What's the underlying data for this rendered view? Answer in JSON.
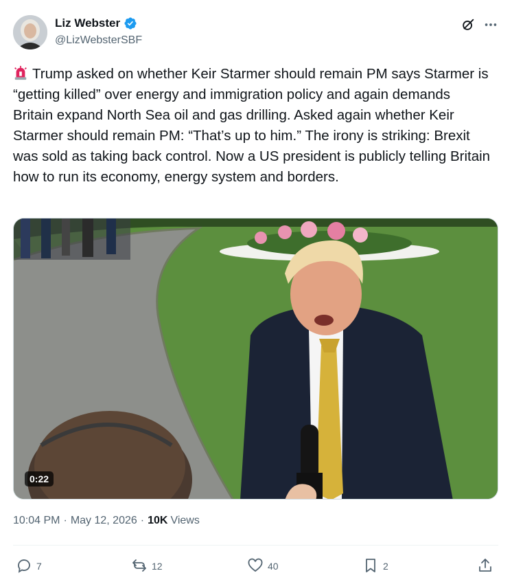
{
  "author": {
    "display_name": "Liz Webster",
    "handle": "@LizWebsterSBF",
    "verified": true,
    "avatar_icon": "profile-photo"
  },
  "header_actions": {
    "grok_icon": "grok-icon",
    "more_icon": "more-horizontal-icon"
  },
  "tweet": {
    "emoji_icon": "police-light-emoji",
    "text": "Trump asked on whether Keir Starmer should remain PM says Starmer is “getting killed” over energy and immigration policy and again demands Britain expand North Sea oil and gas drilling. Asked again whether Keir Starmer should remain PM: “That’s up to him.” The irony is striking: Brexit was sold as taking back control. Now a US president is publicly telling Britain how to run its economy, energy system and borders."
  },
  "media": {
    "type": "video",
    "duration": "0:22"
  },
  "meta": {
    "time": "10:04 PM",
    "separator": "·",
    "date": "May 12, 2026",
    "views_count": "10K",
    "views_label": "Views"
  },
  "actions": {
    "replies": "7",
    "reposts": "12",
    "likes": "40",
    "bookmarks": "2"
  },
  "colors": {
    "text_primary": "#0f1419",
    "text_secondary": "#536471",
    "verified_blue": "#1d9bf0",
    "divider": "#eff3f4"
  }
}
